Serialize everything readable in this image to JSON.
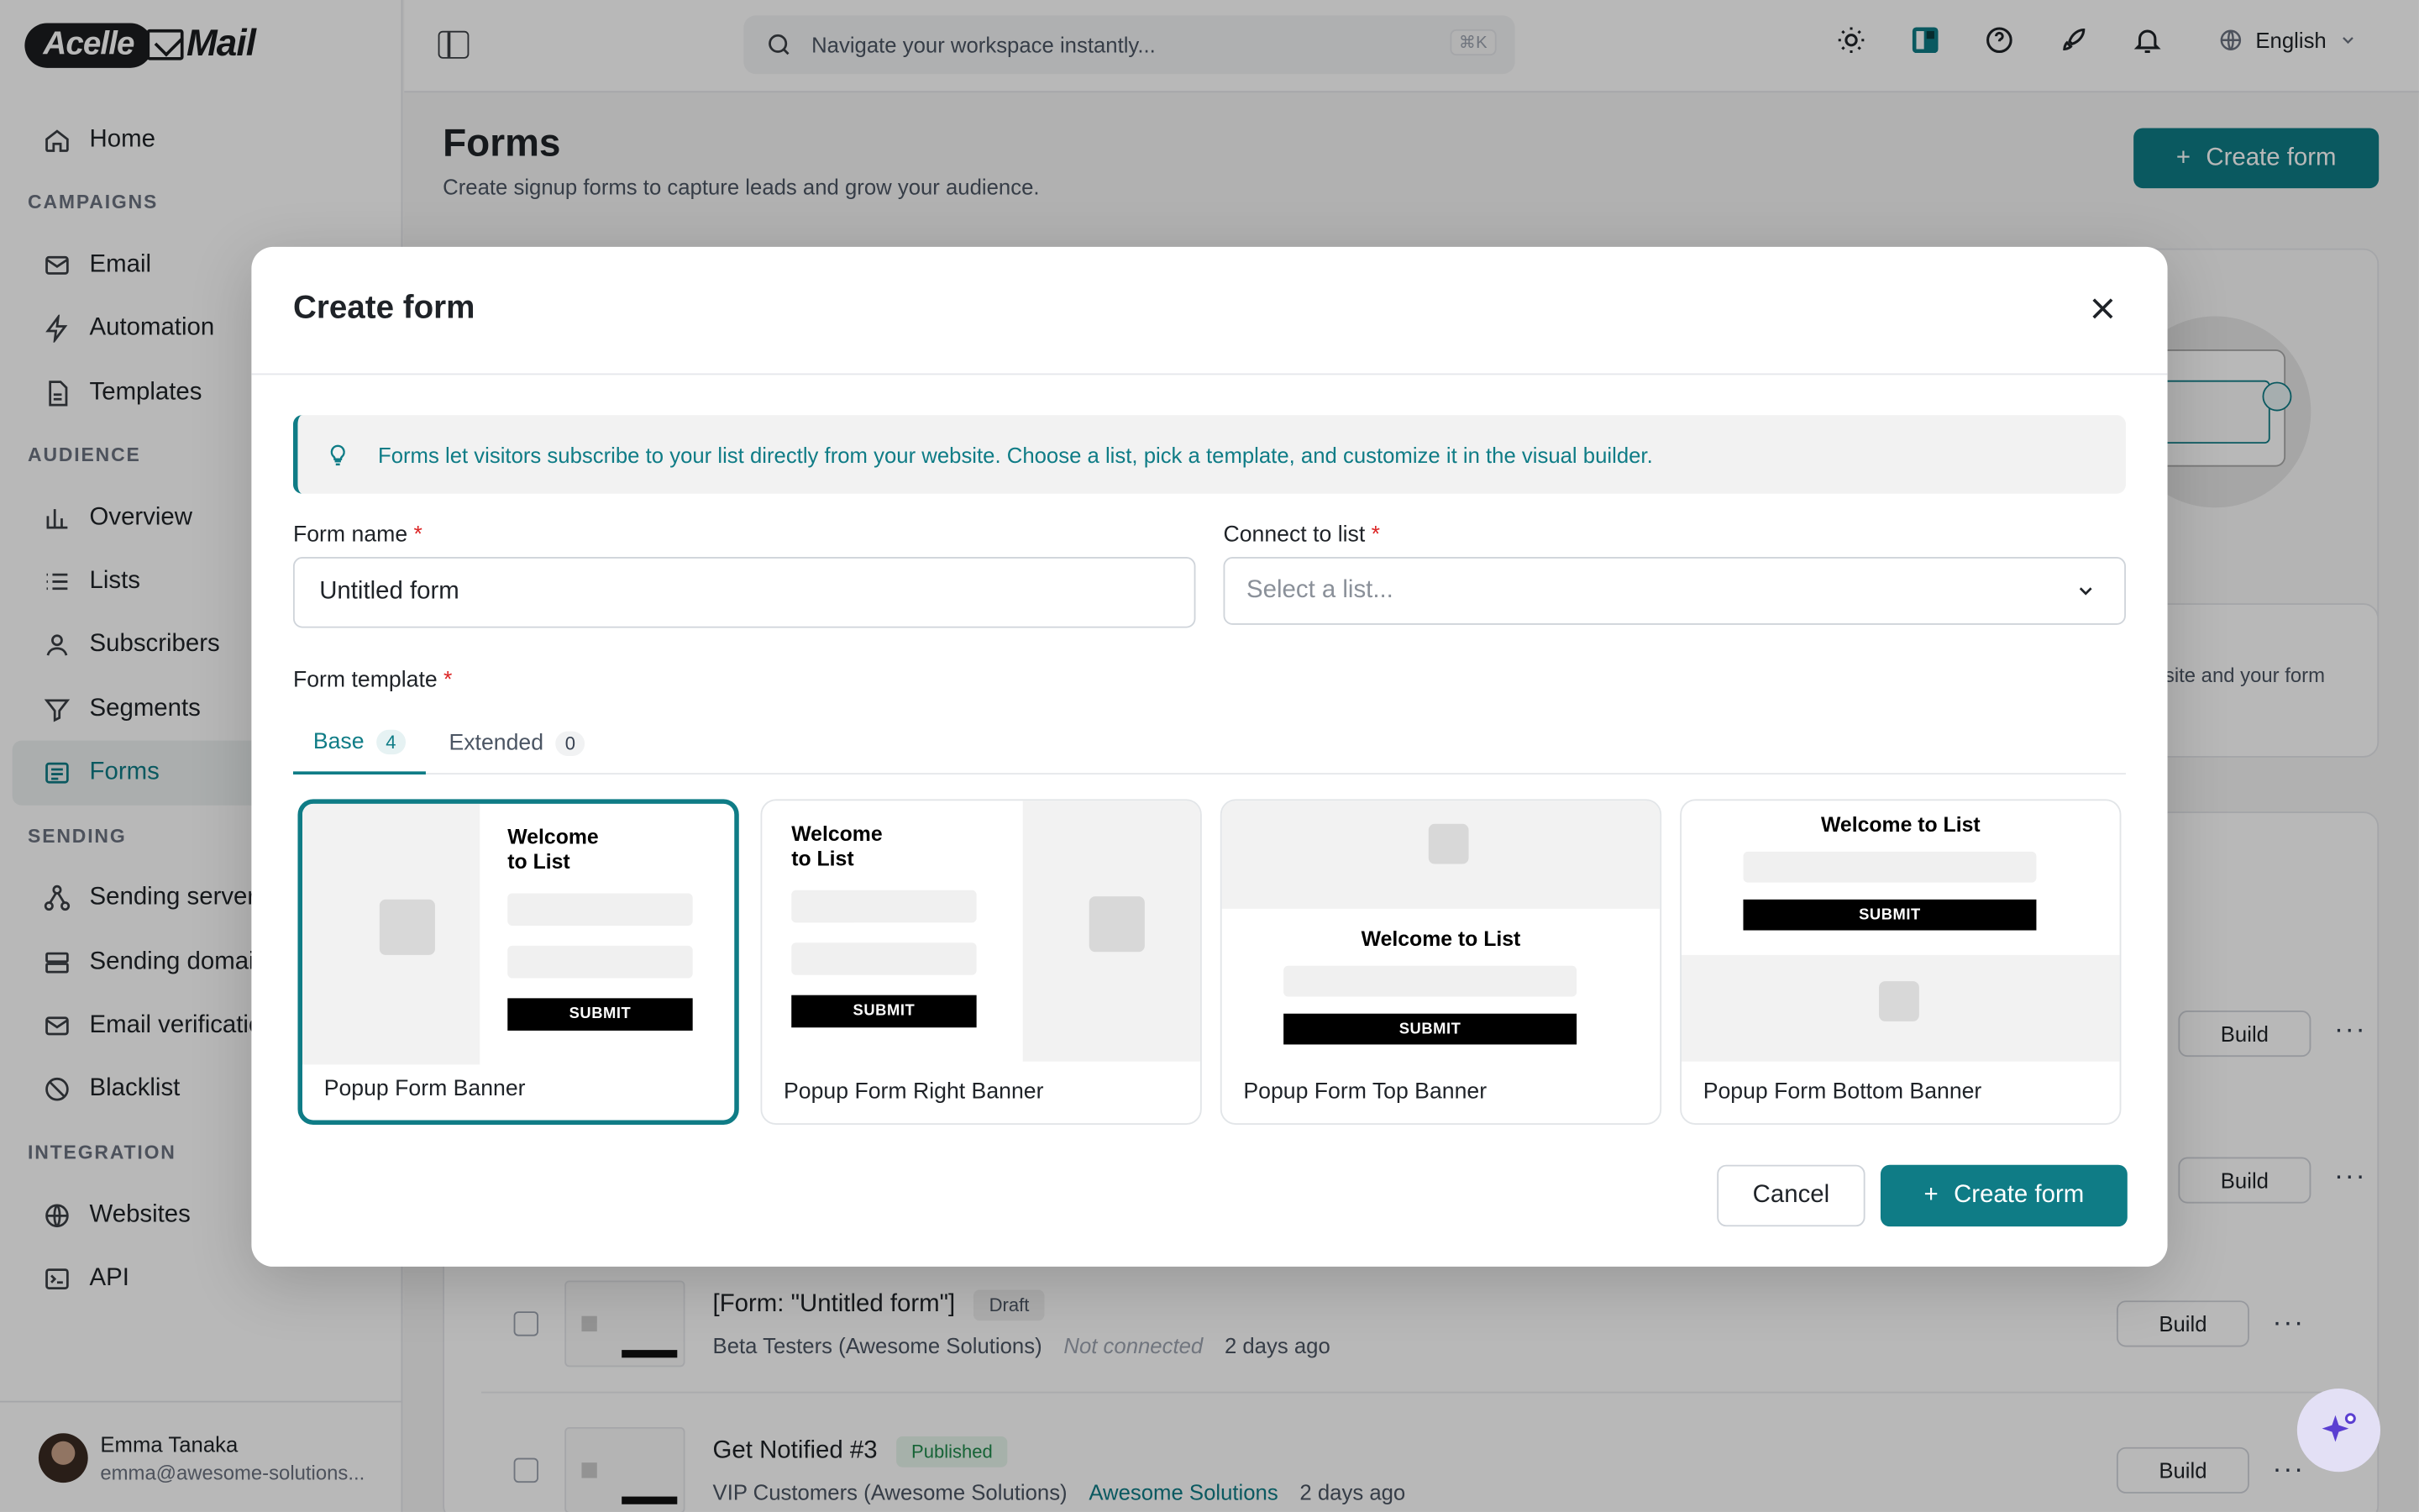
{
  "brand": {
    "logo_pill": "Acelle",
    "logo_text": "Mail"
  },
  "sidebar": {
    "sections": [
      {
        "title": "",
        "items": [
          {
            "label": "Home",
            "icon": "home-icon"
          }
        ]
      },
      {
        "title": "CAMPAIGNS",
        "items": [
          {
            "label": "Email",
            "icon": "mail-icon"
          },
          {
            "label": "Automation",
            "icon": "bolt-icon"
          },
          {
            "label": "Templates",
            "icon": "file-icon"
          }
        ]
      },
      {
        "title": "AUDIENCE",
        "items": [
          {
            "label": "Overview",
            "icon": "bar-chart-icon"
          },
          {
            "label": "Lists",
            "icon": "list-icon"
          },
          {
            "label": "Subscribers",
            "icon": "user-icon"
          },
          {
            "label": "Segments",
            "icon": "filter-icon"
          },
          {
            "label": "Forms",
            "icon": "form-icon",
            "active": true
          }
        ]
      },
      {
        "title": "SENDING",
        "items": [
          {
            "label": "Sending servers",
            "icon": "network-icon"
          },
          {
            "label": "Sending domains",
            "icon": "server-icon"
          },
          {
            "label": "Email verification",
            "icon": "mail-check-icon"
          },
          {
            "label": "Blacklist",
            "icon": "ban-icon"
          }
        ]
      },
      {
        "title": "INTEGRATION",
        "items": [
          {
            "label": "Websites",
            "icon": "globe-icon"
          },
          {
            "label": "API",
            "icon": "terminal-icon"
          }
        ]
      }
    ],
    "user": {
      "name": "Emma Tanaka",
      "email": "emma@awesome-solutions..."
    }
  },
  "header": {
    "search_placeholder": "Navigate your workspace instantly...",
    "shortcut": "⌘K",
    "language": "English"
  },
  "page": {
    "title": "Forms",
    "subtitle": "Create signup forms to capture leads and grow your audience.",
    "create_button": "Create form",
    "bg_hint": "site and your form",
    "rows": [
      {
        "title": "[Form: \"Untitled form\"]",
        "status": "Draft",
        "list": "Beta Testers (Awesome Solutions)",
        "site": "Not connected",
        "time": "2 days ago",
        "build": "Build"
      },
      {
        "title": "Get Notified #3",
        "status": "Published",
        "list": "VIP Customers (Awesome Solutions)",
        "site": "Awesome Solutions",
        "time": "2 days ago",
        "build": "Build"
      }
    ],
    "build_label": "Build"
  },
  "modal": {
    "title": "Create form",
    "info": "Forms let visitors subscribe to your list directly from your website. Choose a list, pick a template, and customize it in the visual builder.",
    "form_name_label": "Form name",
    "form_name_value": "Untitled form",
    "list_label": "Connect to list",
    "list_placeholder": "Select a list...",
    "template_label": "Form template",
    "required_mark": "*",
    "tabs": [
      {
        "label": "Base",
        "count": "4"
      },
      {
        "label": "Extended",
        "count": "0"
      }
    ],
    "templates": [
      {
        "name": "Popup Form Banner",
        "welcome": "Welcome to List",
        "submit": "SUBMIT"
      },
      {
        "name": "Popup Form Right Banner",
        "welcome": "Welcome to List",
        "submit": "SUBMIT"
      },
      {
        "name": "Popup Form Top Banner",
        "welcome": "Welcome to List",
        "submit": "SUBMIT"
      },
      {
        "name": "Popup Form Bottom Banner",
        "welcome": "Welcome to List",
        "submit": "SUBMIT"
      }
    ],
    "welcome_line1": "Welcome",
    "welcome_line2": "to List",
    "cancel": "Cancel",
    "create": "Create form"
  },
  "colors": {
    "accent": "#0f7c86",
    "required": "#dc2626"
  }
}
